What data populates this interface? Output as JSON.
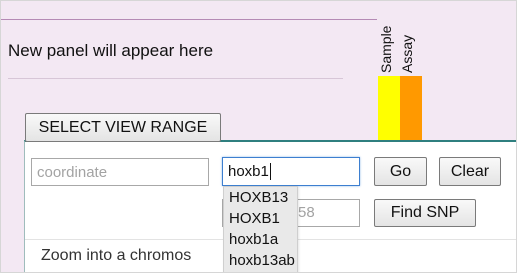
{
  "panel": {
    "placeholder_text": "New panel will appear here"
  },
  "tracks": {
    "sample_label": "Sample",
    "assay_label": "Assay",
    "sample_color": "#ffff00",
    "assay_color": "#ff9900"
  },
  "toolbar": {
    "select_view_range_label": "SELECT VIEW RANGE"
  },
  "search": {
    "coordinate_placeholder": "coordinate",
    "gene_value": "hoxb1",
    "go_label": "Go",
    "clear_label": "Clear",
    "snp_partial_text": "58",
    "find_snp_label": "Find SNP",
    "zoom_hint": "Zoom into a chromos"
  },
  "autocomplete": {
    "items": [
      "HOXB13",
      "HOXB1",
      "hoxb1a",
      "hoxb13ab"
    ]
  },
  "colors": {
    "panel_background": "#f3e8f3",
    "accent_teal": "#2f7f7f",
    "focus_blue": "#3d7fd0"
  }
}
